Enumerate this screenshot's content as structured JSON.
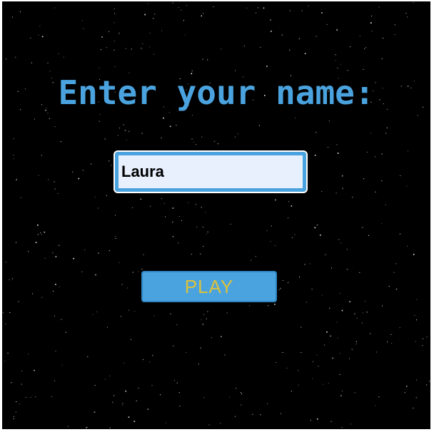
{
  "screen": {
    "title": "Enter your name:",
    "name_input_value": "Laura",
    "play_label": "PLAY"
  },
  "colors": {
    "background": "#000000",
    "title": "#4aa3df",
    "button_bg": "#4aa3df",
    "button_text": "#dcc13a",
    "input_bg": "#e8f0fe",
    "input_border": "#4aa3df"
  }
}
